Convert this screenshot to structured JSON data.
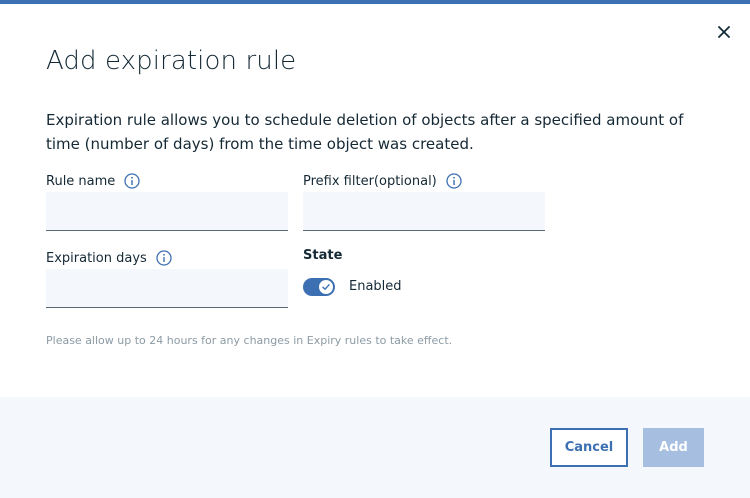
{
  "colors": {
    "accent": "#3d70b2",
    "disabled_button": "#a6bfe0",
    "field_bg": "#f4f7fb"
  },
  "dialog": {
    "title": "Add expiration rule",
    "description": "Expiration rule allows you to schedule deletion of objects after a specified amount of time (number of days) from the time object was created.",
    "close_icon": "close-icon"
  },
  "form": {
    "rule_name": {
      "label": "Rule name",
      "value": "",
      "icon": "info-icon"
    },
    "prefix_filter": {
      "label": "Prefix filter(optional)",
      "value": "",
      "icon": "info-icon"
    },
    "expiration_days": {
      "label": "Expiration days",
      "value": "",
      "icon": "info-icon"
    },
    "state": {
      "label": "State",
      "toggle_label": "Enabled",
      "enabled": true
    }
  },
  "note": "Please allow up to 24 hours for any changes in Expiry rules to take effect.",
  "footer": {
    "cancel_label": "Cancel",
    "add_label": "Add"
  }
}
